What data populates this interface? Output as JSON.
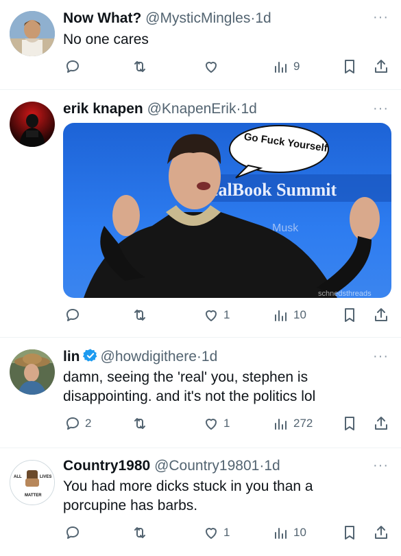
{
  "tweets": [
    {
      "name": "Now What?",
      "handle": "@MysticMingles",
      "time": "1d",
      "text": "No one cares",
      "replies": "",
      "retweets": "",
      "likes": "",
      "views": "9"
    },
    {
      "name": "erik knapen",
      "handle": "@KnapenErik",
      "time": "1d",
      "text": "",
      "replies": "",
      "retweets": "",
      "likes": "1",
      "views": "10",
      "media": {
        "speech_bubble": "Go Fuck Yourself",
        "bg_sign": "ealBook Summit",
        "bg_sign2": "Musk",
        "watermark": "schnedsthreads"
      }
    },
    {
      "name": "lin",
      "handle": "@howdigithere",
      "time": "1d",
      "text_line1": "damn, seeing the 'real' you, stephen is",
      "text_line2": "disappointing. and it's not the politics lol",
      "replies": "2",
      "retweets": "",
      "likes": "1",
      "views": "272",
      "verified": true
    },
    {
      "name": "Country1980",
      "handle": "@Country19801",
      "time": "1d",
      "text_line1": "You had more dicks stuck in you than a",
      "text_line2": "porcupine has barbs.",
      "replies": "",
      "retweets": "",
      "likes": "1",
      "views": "10",
      "avatar_text": {
        "left": "ALL",
        "right": "LIVES",
        "bottom": "MATTER"
      }
    }
  ],
  "colors": {
    "icon": "#536471",
    "name": "#0f1419",
    "handle": "#536471",
    "verified": "#1d9bf0",
    "divider": "#eff3f4"
  },
  "icons": [
    "reply-icon",
    "retweet-icon",
    "like-icon",
    "views-icon",
    "bookmark-icon",
    "share-icon",
    "more-icon"
  ]
}
